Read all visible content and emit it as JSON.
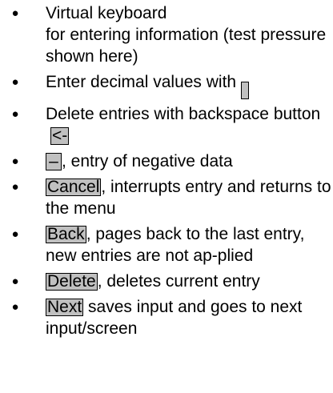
{
  "items": [
    {
      "text": "Virtual keyboard\nfor entering information (test pressure shown here)"
    },
    {
      "text_before": "Enter decimal values with",
      "key": "."
    },
    {
      "text_before": "Delete entries with backspace button",
      "key": "<-"
    },
    {
      "key": "–",
      "text_after": ", entry of negative data"
    },
    {
      "key": "Cancel",
      "text_after": ", interrupts entry and returns to the menu"
    },
    {
      "key": "Back",
      "text_after": ", pages back to the last entry, new entries are not ap-plied"
    },
    {
      "key": "Delete",
      "text_after": ", deletes current entry"
    },
    {
      "key": "Next",
      "text_after": " saves input and goes to next input/screen"
    }
  ]
}
